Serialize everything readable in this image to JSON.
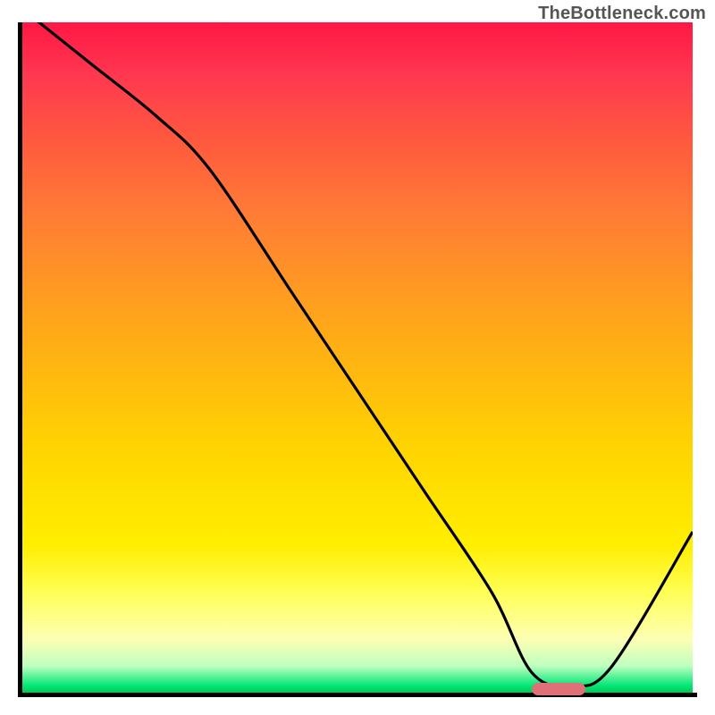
{
  "watermark": "TheBottleneck.com",
  "colors": {
    "gradient_top": "#ff1744",
    "gradient_mid": "#ffd500",
    "gradient_bottom": "#00c853",
    "axis": "#000000",
    "curve": "#000000",
    "marker": "#e07078"
  },
  "chart_data": {
    "type": "line",
    "title": "",
    "xlabel": "",
    "ylabel": "",
    "xlim": [
      0,
      100
    ],
    "ylim": [
      0,
      100
    ],
    "series": [
      {
        "name": "bottleneck-curve",
        "x": [
          0,
          10,
          20,
          28,
          40,
          50,
          60,
          70,
          76,
          82,
          88,
          100
        ],
        "values": [
          102,
          94,
          86,
          78,
          60,
          45,
          30,
          15,
          3,
          1,
          4,
          24
        ]
      }
    ],
    "annotations": [
      {
        "name": "optimal-marker",
        "x": 80,
        "y": 0.5,
        "width_pct": 8
      }
    ],
    "background": "vertical-gradient red→orange→yellow→green"
  }
}
